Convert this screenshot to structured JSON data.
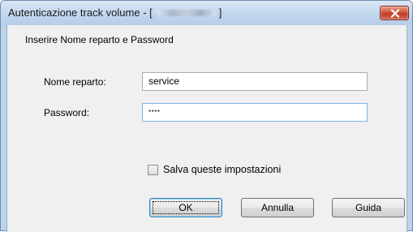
{
  "window": {
    "title_prefix": "Autenticazione track volume - [",
    "title_suffix": "]"
  },
  "dialog": {
    "instruction": "Inserire Nome reparto e Password",
    "department_label": "Nome reparto:",
    "department_value": "service",
    "password_label": "Password:",
    "password_value": "****",
    "save_settings_label": "Salva queste impostazioni",
    "save_settings_checked": false
  },
  "buttons": {
    "ok": "OK",
    "cancel": "Annulla",
    "help": "Guida"
  },
  "icons": {
    "close": "close-icon",
    "checkbox": "checkbox-icon"
  }
}
